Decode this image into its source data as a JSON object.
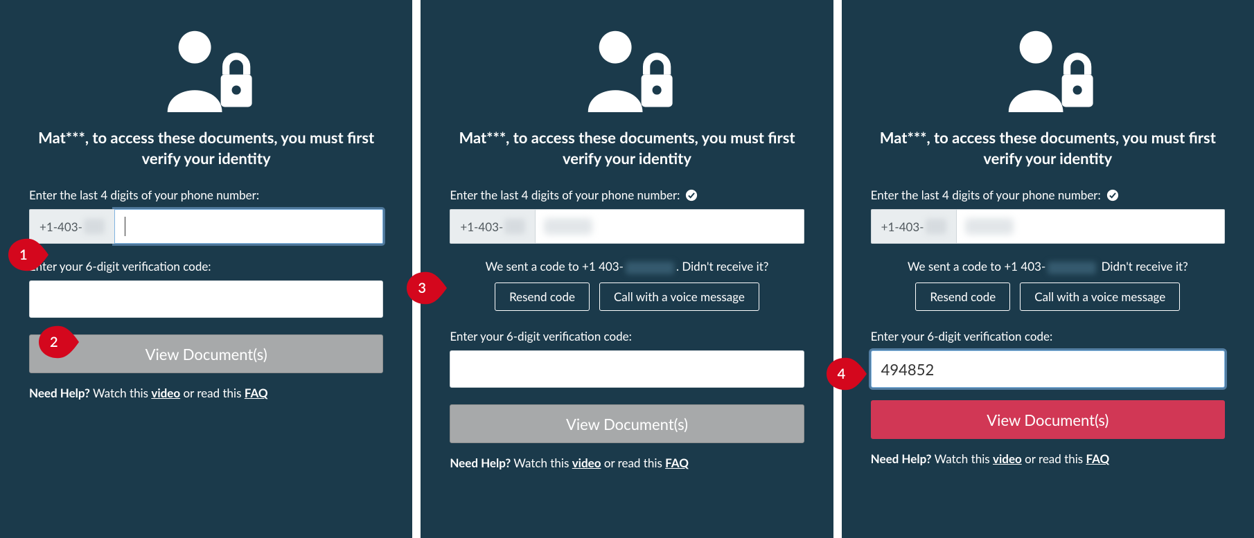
{
  "heading": "Mat***, to access these documents, you must first verify your identity",
  "phone_label": "Enter the last 4 digits of your phone number:",
  "phone_prefix": "+1-403-",
  "sent_prefix": "We sent a code to +1 403-",
  "sent_suffix_q": ". Didn't receive it?",
  "sent_suffix_q3": "Didn't receive it?",
  "resend_label": "Resend code",
  "voice_label": "Call with a voice message",
  "code_label": "Enter your 6-digit verification code:",
  "code_value_panel3": "494852",
  "view_label": "View Document(s)",
  "help_bold": "Need Help?",
  "help_text1": "  Watch this ",
  "help_link1": "video",
  "help_text2": " or read this ",
  "help_link2": "FAQ",
  "callouts": {
    "c1": "1",
    "c2": "2",
    "c3": "3",
    "c4": "4"
  }
}
